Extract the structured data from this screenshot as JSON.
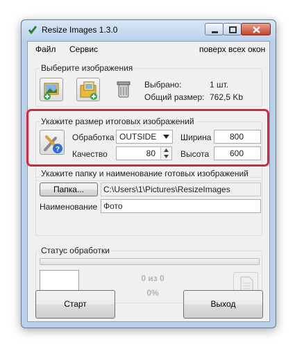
{
  "window": {
    "title": "Resize Images 1.3.0"
  },
  "menu": {
    "file": "Файл",
    "service": "Сервис",
    "on_top": "поверх всех окон"
  },
  "select_group": {
    "label": "Выберите изображения",
    "selected_label": "Выбрано:",
    "selected_value": "1 шт.",
    "total_size_label": "Общий размер:",
    "total_size_value": "762,5 Kb"
  },
  "size_group": {
    "label": "Укажите размер итоговых изображений",
    "processing_label": "Обработка",
    "processing_value": "OUTSIDE",
    "quality_label": "Качество",
    "quality_value": "80",
    "width_label": "Ширина",
    "width_value": "800",
    "height_label": "Высота",
    "height_value": "600"
  },
  "output_group": {
    "label": "Укажите папку и наименование готовых изображений",
    "folder_button": "Папка...",
    "folder_path": "C:\\Users\\1\\Pictures\\ResizeImages",
    "name_label": "Наименование",
    "name_value": "Фото"
  },
  "status_group": {
    "label": "Статус обработки",
    "count_text": "0 из 0",
    "percent_text": "0%",
    "progress": 0
  },
  "buttons": {
    "start": "Старт",
    "exit": "Выход"
  },
  "colors": {
    "highlight": "#d82636",
    "title_bg": "#b9d1ea",
    "client_bg": "#f0f0f0"
  }
}
